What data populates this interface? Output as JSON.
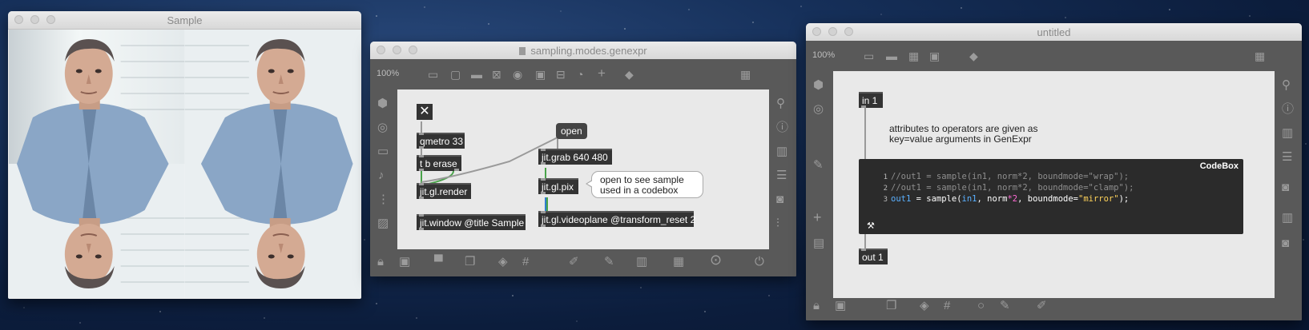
{
  "desktop": {
    "background": "starry-night"
  },
  "window_sample": {
    "title": "Sample",
    "content": "mirrored video frame of a person"
  },
  "window_genexpr": {
    "title": "sampling.modes.genexpr",
    "zoom": "100%",
    "objects": {
      "toggle": "✕",
      "qmetro": "qmetro 33",
      "tb_erase": "t b erase",
      "render": "jit.gl.render",
      "window": "jit.window @title Sample",
      "open_msg": "open",
      "grab": "jit.grab 640 480",
      "pix": "jit.gl.pix",
      "videoplane": "jit.gl.videoplane @transform_reset 2"
    },
    "bubble": {
      "line1": "open to see sample",
      "line2": "used in a codebox"
    }
  },
  "window_untitled": {
    "title": "untitled",
    "zoom": "100%",
    "in_object": "in 1",
    "out_object": "out 1",
    "comment": {
      "line1": "attributes to operators are given as",
      "line2": "key=value arguments in GenExpr"
    },
    "codebox": {
      "title": "CodeBox",
      "line_numbers": [
        "1",
        "2",
        "3"
      ],
      "line1": "//out1 = sample(in1, norm*2, boundmode=\"wrap\");",
      "line2": "//out1 = sample(in1, norm*2, boundmode=\"clamp\");",
      "line3": {
        "var": "out1",
        "eq": " = ",
        "fn": "sample(",
        "arg1": "in1",
        "sep1": ", ",
        "arg2": "norm",
        "star": "*",
        "num": "2",
        "sep2": ", ",
        "attr": "boundmode",
        "eq2": "=",
        "str": "\"mirror\"",
        "end": ");"
      }
    }
  },
  "colors": {
    "patcher_frame": "#595959",
    "canvas": "#e9e9e9",
    "object_box": "#333333",
    "codebox_bg": "#2b2b2b",
    "code_identifier": "#5ab0ff",
    "code_string": "#ffd35a",
    "code_number": "#ff6bd5",
    "cord_signal": "#49a34a",
    "cord_matrix": "#2f7fd0"
  }
}
